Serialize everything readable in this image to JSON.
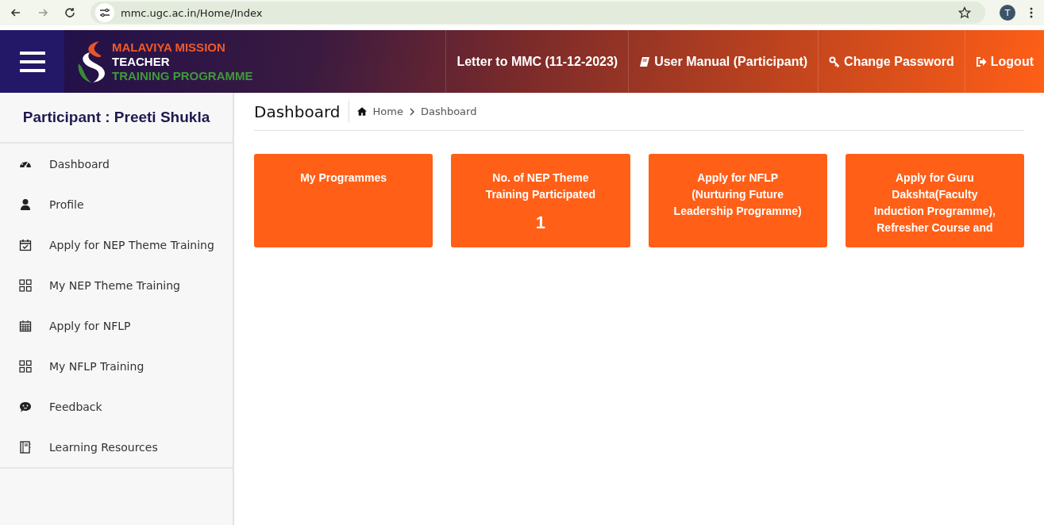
{
  "browser": {
    "url": "mmc.ugc.ac.in/Home/Index",
    "profile_initial": "T"
  },
  "header": {
    "logo": [
      "MALAVIYA MISSION",
      "TEACHER",
      "TRAINING PROGRAMME"
    ],
    "nav": [
      {
        "label": "Letter to MMC (11-12-2023)"
      },
      {
        "label": "User Manual (Participant)"
      },
      {
        "label": "Change Password"
      },
      {
        "label": "Logout"
      }
    ]
  },
  "sidebar": {
    "title": "Participant : Preeti Shukla",
    "items": [
      {
        "label": "Dashboard"
      },
      {
        "label": "Profile"
      },
      {
        "label": "Apply for NEP Theme Training"
      },
      {
        "label": "My NEP Theme Training"
      },
      {
        "label": "Apply for NFLP"
      },
      {
        "label": "My NFLP Training"
      },
      {
        "label": "Feedback"
      },
      {
        "label": "Learning Resources"
      }
    ]
  },
  "page": {
    "title": "Dashboard",
    "breadcrumb": [
      "Home",
      "Dashboard"
    ]
  },
  "cards": [
    {
      "title": "My Programmes"
    },
    {
      "title": "No. of NEP Theme Training Participated",
      "value": "1"
    },
    {
      "title": "Apply for NFLP (Nurturing Future Leadership Programme)"
    },
    {
      "title": "Apply for Guru Dakshta(Faculty Induction Programme), Refresher Course and"
    }
  ]
}
